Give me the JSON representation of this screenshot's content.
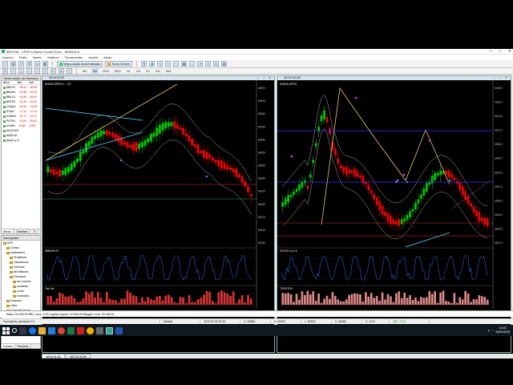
{
  "window": {
    "title": "8897934 - XPMT's Banco Conta Demo - WINDOL8",
    "controls": [
      "—",
      "□",
      "✕"
    ]
  },
  "menu": [
    "Arquivo",
    "Exibir",
    "Inserir",
    "Gráficos",
    "Ferramentas",
    "Janela",
    "Ajuda"
  ],
  "toolbar": {
    "algo_label": "Negociação Automatizada",
    "new_order_label": "Nova Ordem",
    "timeframes": [
      "M1",
      "M5",
      "M15",
      "M30",
      "H1",
      "H4",
      "D1",
      "W1",
      "MN"
    ]
  },
  "market_watch": {
    "title": "Observação do Mercado",
    "columns": [
      "Ativo",
      "Bid",
      "Ask"
    ],
    "rows": [
      {
        "symbol": "ABEV3",
        "bid": "18.52",
        "ask": "18.54"
      },
      {
        "symbol": "BBAS3",
        "bid": "31.98",
        "ask": "31.99"
      },
      {
        "symbol": "BBDC4",
        "bid": "44.80",
        "ask": "44.81"
      },
      {
        "symbol": "BRFS3",
        "bid": "24.30",
        "ask": "24.32"
      },
      {
        "symbol": "CSNA3",
        "bid": "13.94",
        "ask": "13.95"
      },
      {
        "symbol": "ITSA4",
        "bid": "17.11",
        "ask": "17.12"
      },
      {
        "symbol": "GGBR4",
        "bid": "13.71",
        "ask": "13.72"
      },
      {
        "symbol": "PETR4",
        "bid": "20.60",
        "ask": "20.61"
      },
      {
        "symbol": "USIM5",
        "bid": "8.58",
        "ask": "8.59"
      },
      {
        "symbol": "WDOH18",
        "bid": "",
        "ask": ""
      },
      {
        "symbol": "WINH18",
        "bid": "",
        "ask": ""
      },
      {
        "symbol": "clique p/ add",
        "bid": "",
        "ask": ""
      }
    ],
    "tabs": [
      "Ativos",
      "Detalhes",
      "Ti"
    ]
  },
  "navigator": {
    "title": "Navegador",
    "items": [
      {
        "label": "MT5",
        "indent": 0
      },
      {
        "label": "Contas",
        "indent": 1
      },
      {
        "label": "Indicadores",
        "indent": 1
      },
      {
        "label": "Tendência",
        "indent": 2
      },
      {
        "label": "Osciladores",
        "indent": 2
      },
      {
        "label": "Volumes",
        "indent": 2
      },
      {
        "label": "Bill Williams",
        "indent": 2
      },
      {
        "label": "Exemplos",
        "indent": 2
      },
      {
        "label": "bsv volume",
        "indent": 3
      },
      {
        "label": "camarilla",
        "indent": 3
      },
      {
        "label": "curva",
        "indent": 3
      },
      {
        "label": "Examples",
        "indent": 3
      },
      {
        "label": "Expertos",
        "indent": 1
      },
      {
        "label": "vídeo",
        "indent": 1
      },
      {
        "label": "Consultar Ajuda",
        "indent": 1
      },
      {
        "label": "Scripts",
        "indent": 1
      }
    ],
    "tabs": [
      "Comum",
      "Favoritos"
    ]
  },
  "chart_left": {
    "title": "WINH18,M5",
    "overlay": "ENVELOPES 2... ST",
    "oscillator_label": "WINH18 ST",
    "volume_label": "Tick Vol",
    "price_ticks": [
      "82970",
      "82900",
      "82830",
      "82760",
      "82690",
      "82620",
      "82550",
      "82480",
      "82410",
      "82340",
      "82270",
      "82200",
      "82130"
    ],
    "time_ticks": [
      "1 Feb 2018",
      "1 Feb 10:00",
      "1 Feb 11:00",
      "1 Feb 12:00",
      "1 Feb 13:00",
      "1 Feb 14:00",
      "1 Feb 15:00",
      "1 Feb 16:00",
      "1 Feb 17:00"
    ]
  },
  "chart_right": {
    "title": "WDOH18,M5",
    "overlay": "ENVELOPES",
    "oscillator_label": "STOCH 14,3,3",
    "volume_label": "TOPHTOS",
    "price_ticks": [
      "3218.5",
      "3216.0",
      "3213.5",
      "3211.0",
      "3208.5",
      "3206.0",
      "3203.5",
      "3201.0",
      "3198.5",
      "3196.0",
      "3193.5",
      "3191.0"
    ],
    "time_ticks": [
      "1 Feb 2018",
      "1 Feb 10:00",
      "1 Feb 11:00",
      "1 Feb 12:00",
      "1 Feb 13:00",
      "1 Feb 14:00",
      "1 Feb 15:00",
      "1 Feb 16:00"
    ]
  },
  "chart_tabs": [
    "WINH18,M5",
    "WDOH18,M5"
  ],
  "terminal": {
    "text": "Saldo: 94 096.00 BRL   Lucro: 0.00   Capital Líquido: 94 096.00   Margem Livre: 94 096.00"
  },
  "statusbar": {
    "help": "Para Ajuda, pressione F1",
    "profile": "Default",
    "datetime": "2018.02.06 15:25",
    "open": "O: 82880",
    "high": "H: 82920",
    "low": "L: 82825",
    "close": "C: 82880",
    "volume": "V: 1120",
    "connection": "451 / 3 Kb"
  },
  "taskbar": {
    "time": "16:00",
    "date": "06/02/2018"
  }
}
